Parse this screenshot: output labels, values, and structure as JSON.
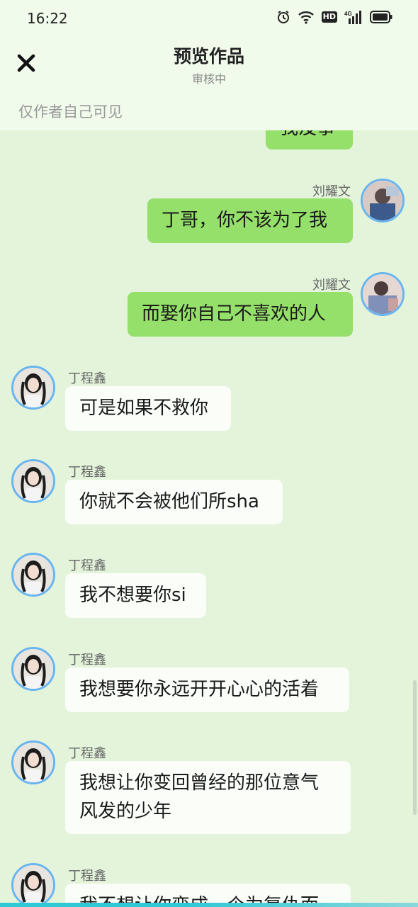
{
  "status_bar": {
    "time": "16:22",
    "hd": "HD",
    "net": "4G"
  },
  "header": {
    "title": "预览作品",
    "subtitle": "审核中",
    "visibility": "仅作者自己可见"
  },
  "messages": [
    {
      "side": "right",
      "sender": "",
      "text": "我没事"
    },
    {
      "side": "right",
      "sender": "刘耀文",
      "text": "丁哥，你不该为了我"
    },
    {
      "side": "right",
      "sender": "刘耀文",
      "text": "而娶你自己不喜欢的人"
    },
    {
      "side": "left",
      "sender": "丁程鑫",
      "text": "可是如果不救你"
    },
    {
      "side": "left",
      "sender": "丁程鑫",
      "text": "你就不会被他们所sha"
    },
    {
      "side": "left",
      "sender": "丁程鑫",
      "text": "我不想要你si"
    },
    {
      "side": "left",
      "sender": "丁程鑫",
      "text": "我想要你永远开开心心的活着"
    },
    {
      "side": "left",
      "sender": "丁程鑫",
      "text": "我想让你变回曾经的那位意气风发的少年"
    },
    {
      "side": "left",
      "sender": "丁程鑫",
      "text": "我不想让你变成一个为复仇而"
    }
  ],
  "colors": {
    "right_bubble": "#95e06a",
    "left_bubble": "#fafdf8",
    "background": "#e3f4db",
    "avatar_ring": "#69b5ef"
  },
  "icons": {
    "close": "close-icon",
    "alarm": "alarm-icon",
    "wifi": "wifi-icon",
    "signal": "signal-icon",
    "battery": "battery-icon"
  }
}
